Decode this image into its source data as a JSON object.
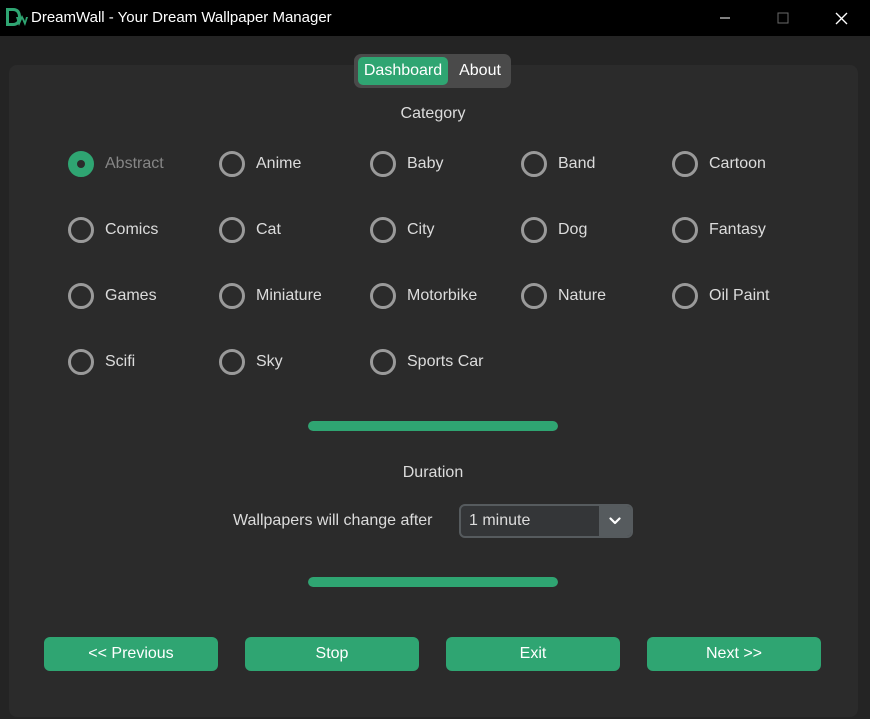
{
  "window": {
    "title": "DreamWall - Your Dream Wallpaper Manager",
    "logo_icon": "dreamwall-logo",
    "controls": [
      "minimize-icon",
      "maximize-icon",
      "close-icon"
    ]
  },
  "tabs": [
    {
      "label": "Dashboard",
      "active": true
    },
    {
      "label": "About",
      "active": false
    }
  ],
  "category": {
    "title": "Category",
    "selected": "Abstract",
    "options": [
      {
        "label": "Abstract",
        "checked": true
      },
      {
        "label": "Anime",
        "checked": false
      },
      {
        "label": "Baby",
        "checked": false
      },
      {
        "label": "Band",
        "checked": false
      },
      {
        "label": "Cartoon",
        "checked": false
      },
      {
        "label": "Comics",
        "checked": false
      },
      {
        "label": "Cat",
        "checked": false
      },
      {
        "label": "City",
        "checked": false
      },
      {
        "label": "Dog",
        "checked": false
      },
      {
        "label": "Fantasy",
        "checked": false
      },
      {
        "label": "Games",
        "checked": false
      },
      {
        "label": "Miniature",
        "checked": false
      },
      {
        "label": "Motorbike",
        "checked": false
      },
      {
        "label": "Nature",
        "checked": false
      },
      {
        "label": "Oil Paint",
        "checked": false
      },
      {
        "label": "Scifi",
        "checked": false
      },
      {
        "label": "Sky",
        "checked": false
      },
      {
        "label": "Sports Car",
        "checked": false
      }
    ]
  },
  "progress_top": {
    "value": 1.0
  },
  "duration": {
    "title": "Duration",
    "label": "Wallpapers will change after",
    "selected": "1 minute",
    "dropdown_icon": "chevron-down-icon"
  },
  "progress_bottom": {
    "value": 1.0
  },
  "buttons": {
    "previous": "<< Previous",
    "stop": "Stop",
    "exit": "Exit",
    "next": "Next >>"
  },
  "colors": {
    "accent": "#2fa572",
    "background": "#242424",
    "panel": "#2b2b2b",
    "titlebar": "#000000",
    "radio_unchecked": "#9a9a9a"
  }
}
